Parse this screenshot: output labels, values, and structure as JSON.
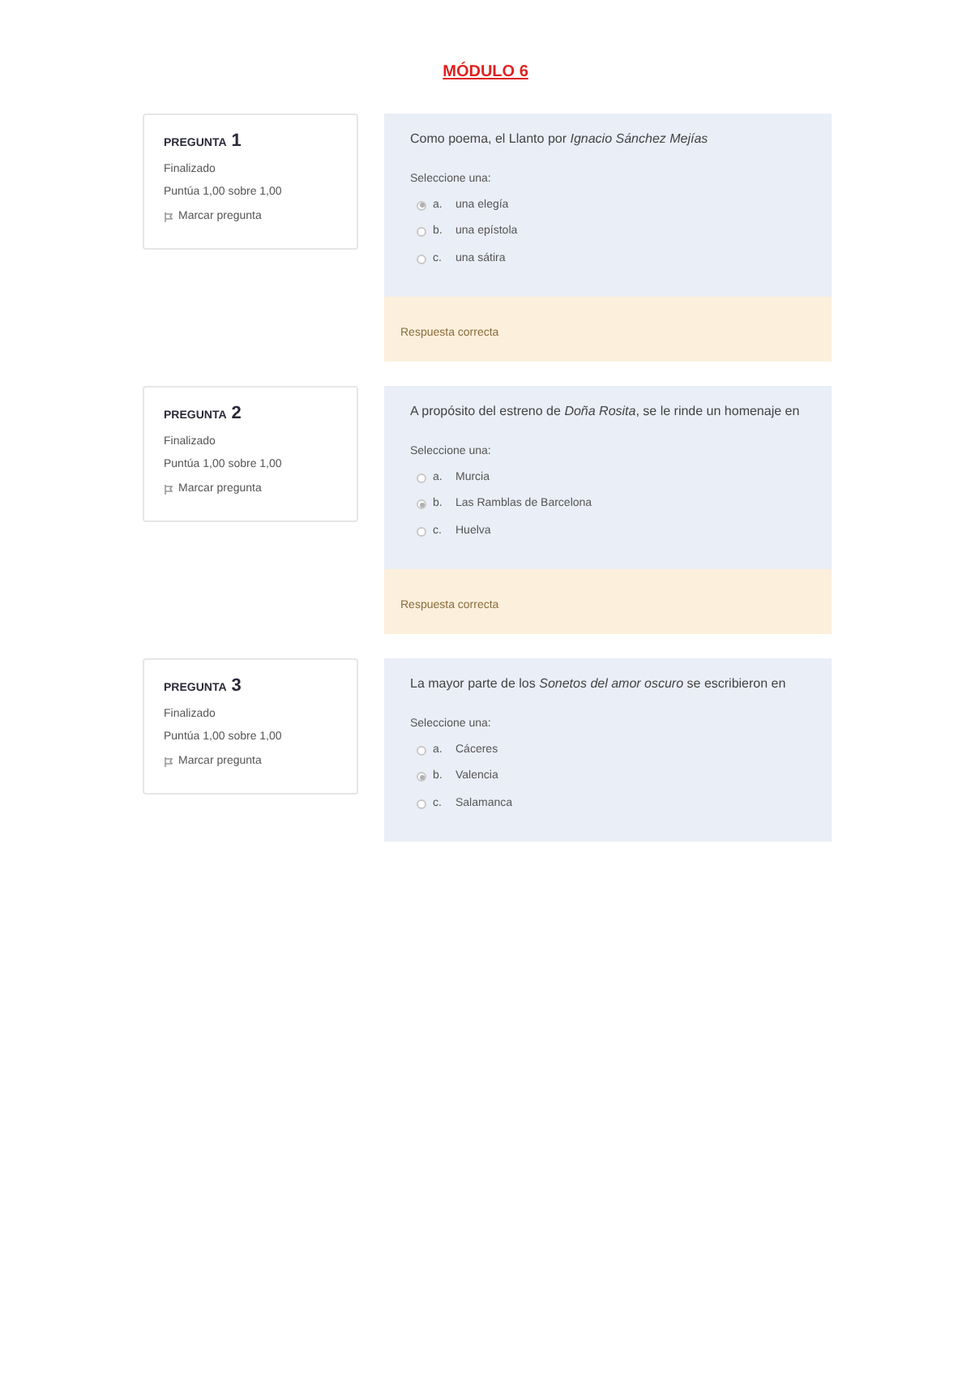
{
  "title": "MÓDULO 6",
  "questions": [
    {
      "label": "PREGUNTA",
      "number": "1",
      "status": "Finalizado",
      "score": "Puntúa 1,00 sobre 1,00",
      "flag": "Marcar pregunta",
      "text": "Como poema, el Llanto por *Ignacio Sánchez Mejías*",
      "prompt": "Seleccione una:",
      "options": [
        {
          "letter": "a.",
          "text": "una elegía",
          "selected": true
        },
        {
          "letter": "b.",
          "text": "una epístola",
          "selected": false
        },
        {
          "letter": "c.",
          "text": "una sátira",
          "selected": false
        }
      ],
      "feedback": "Respuesta correcta"
    },
    {
      "label": "PREGUNTA",
      "number": "2",
      "status": "Finalizado",
      "score": "Puntúa 1,00 sobre 1,00",
      "flag": "Marcar pregunta",
      "text": "A propósito del estreno de *Doña Rosita*, se le rinde un homenaje en",
      "prompt": "Seleccione una:",
      "options": [
        {
          "letter": "a.",
          "text": "Murcia",
          "selected": false
        },
        {
          "letter": "b.",
          "text": "Las Ramblas de Barcelona",
          "selected": true
        },
        {
          "letter": "c.",
          "text": "Huelva",
          "selected": false
        }
      ],
      "feedback": "Respuesta correcta"
    },
    {
      "label": "PREGUNTA",
      "number": "3",
      "status": "Finalizado",
      "score": "Puntúa 1,00 sobre 1,00",
      "flag": "Marcar pregunta",
      "text": "La mayor parte de los *Sonetos del amor oscuro* se escribieron en",
      "prompt": "Seleccione una:",
      "options": [
        {
          "letter": "a.",
          "text": "Cáceres",
          "selected": false
        },
        {
          "letter": "b.",
          "text": "Valencia",
          "selected": true
        },
        {
          "letter": "c.",
          "text": "Salamanca",
          "selected": false
        }
      ]
    }
  ]
}
